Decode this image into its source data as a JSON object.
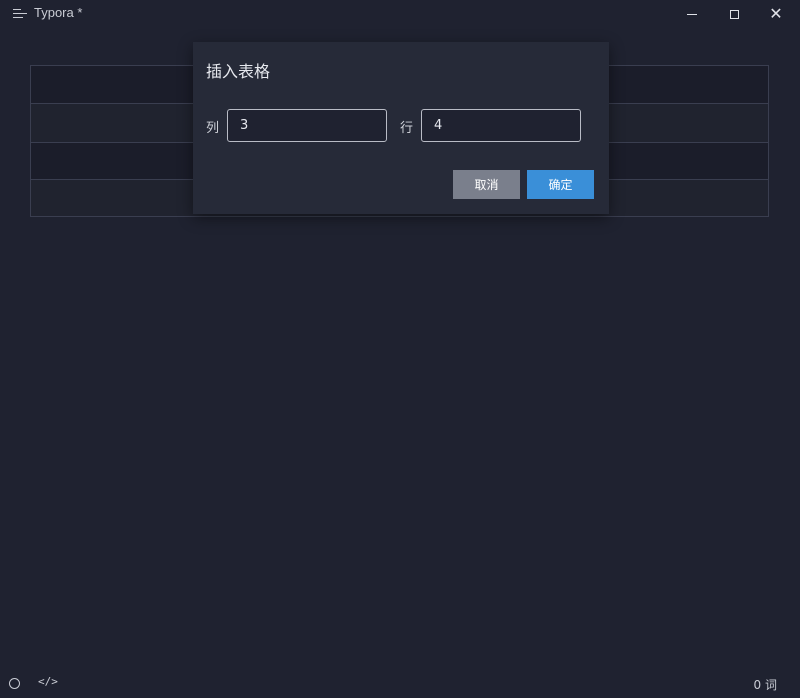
{
  "window": {
    "title": "Typora *",
    "minimize_icon": "minimize-icon",
    "maximize_icon": "maximize-icon",
    "close_glyph": "✕"
  },
  "dialog": {
    "title": "插入表格",
    "columns_label": "列",
    "columns_value": "3",
    "rows_label": "行",
    "rows_value": "4",
    "cancel_label": "取消",
    "ok_label": "确定"
  },
  "statusbar": {
    "source_mode_glyph": "</>",
    "word_count": "0 词"
  },
  "colors": {
    "background": "#1f2230",
    "dialog": "#262a38",
    "accent": "#3a8fd8",
    "cancel": "#7a7f8c"
  }
}
